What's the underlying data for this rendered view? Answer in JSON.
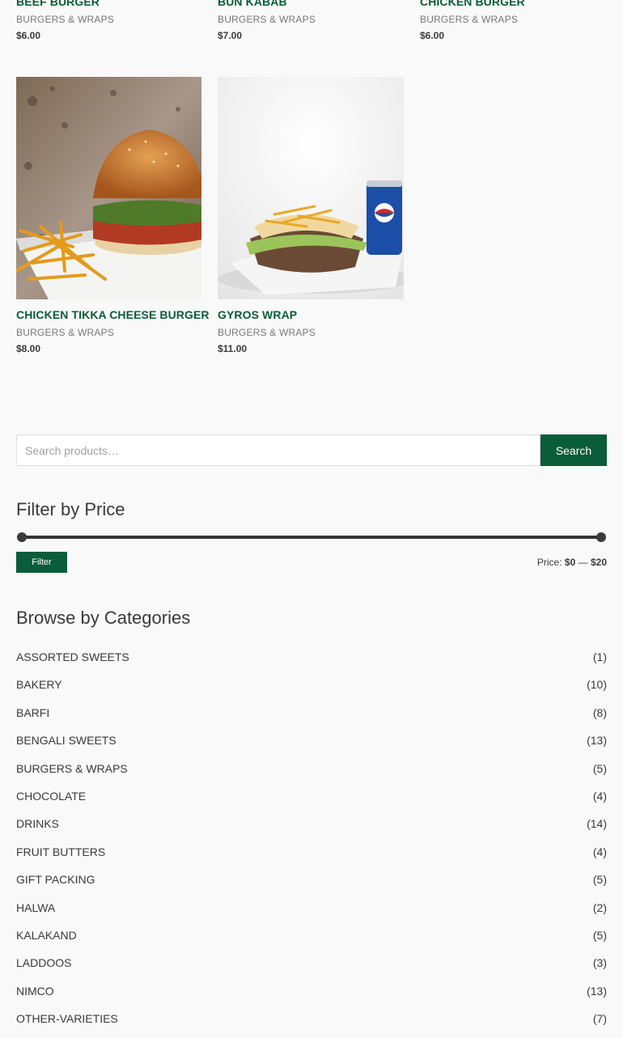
{
  "products_top": [
    {
      "title": "BEEF BURGER",
      "category": "BURGERS & WRAPS",
      "price": "$6.00"
    },
    {
      "title": "BUN KABAB",
      "category": "BURGERS & WRAPS",
      "price": "$7.00"
    },
    {
      "title": "CHICKEN BURGER",
      "category": "BURGERS & WRAPS",
      "price": "$6.00"
    }
  ],
  "products_bottom": [
    {
      "title": "CHICKEN TIKKA CHEESE BURGER",
      "category": "BURGERS & WRAPS",
      "price": "$8.00"
    },
    {
      "title": "GYROS WRAP",
      "category": "BURGERS & WRAPS",
      "price": "$11.00"
    }
  ],
  "search": {
    "placeholder": "Search products…",
    "button_label": "Search"
  },
  "price_filter": {
    "title": "Filter by Price",
    "button_label": "Filter",
    "price_prefix": "Price:",
    "min": "$0",
    "separator": "—",
    "max": "$20"
  },
  "categories": {
    "title": "Browse by Categories",
    "items": [
      {
        "name": "ASSORTED SWEETS",
        "count": "(1)"
      },
      {
        "name": "BAKERY",
        "count": "(10)"
      },
      {
        "name": "BARFI",
        "count": "(8)"
      },
      {
        "name": "BENGALI SWEETS",
        "count": "(13)"
      },
      {
        "name": "BURGERS & WRAPS",
        "count": "(5)"
      },
      {
        "name": "CHOCOLATE",
        "count": "(4)"
      },
      {
        "name": "DRINKS",
        "count": "(14)"
      },
      {
        "name": "FRUIT BUTTERS",
        "count": "(4)"
      },
      {
        "name": "GIFT PACKING",
        "count": "(5)"
      },
      {
        "name": "HALWA",
        "count": "(2)"
      },
      {
        "name": "KALAKAND",
        "count": "(5)"
      },
      {
        "name": "LADDOOS",
        "count": "(3)"
      },
      {
        "name": "NIMCO",
        "count": "(13)"
      },
      {
        "name": "OTHER-VARIETIES",
        "count": "(7)"
      }
    ]
  },
  "colors": {
    "accent": "#0a5c3a",
    "background": "#f9f9f9",
    "text": "#3a3a3a"
  }
}
